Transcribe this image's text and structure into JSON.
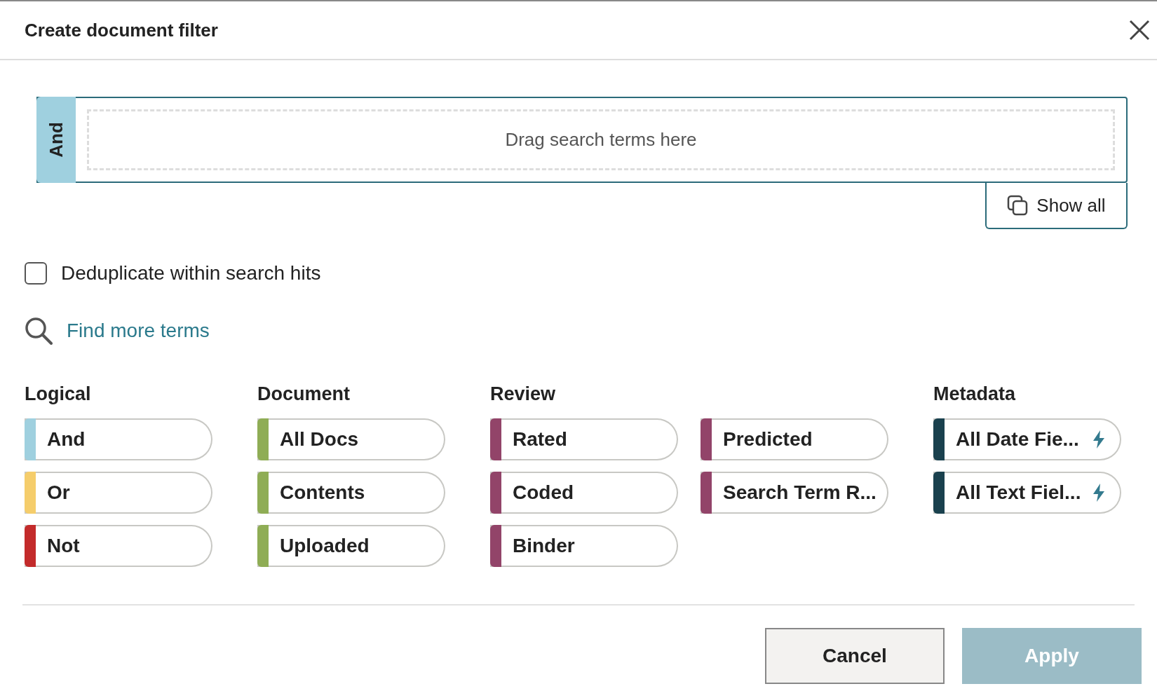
{
  "dialog": {
    "title": "Create document filter"
  },
  "drop_zone": {
    "operator": "And",
    "placeholder": "Drag search terms here"
  },
  "show_all_button": "Show all",
  "dedupe": {
    "label": "Deduplicate within search hits",
    "checked": false
  },
  "find_more_link": "Find more terms",
  "groups": [
    {
      "title": "Logical",
      "terms": [
        {
          "label": "And",
          "kind": "term",
          "color": "#9fd0df"
        },
        {
          "label": "Or",
          "kind": "term",
          "color": "#f5cd6b"
        },
        {
          "label": "Not",
          "kind": "term",
          "color": "#c32b2b"
        }
      ]
    },
    {
      "title": "Document",
      "terms": [
        {
          "label": "All Docs",
          "kind": "term",
          "color": "#8fad55"
        },
        {
          "label": "Contents",
          "kind": "term",
          "color": "#8fad55"
        },
        {
          "label": "Uploaded",
          "kind": "term",
          "color": "#8fad55"
        }
      ]
    },
    {
      "title": "Review",
      "terms": [
        {
          "label": "Rated",
          "kind": "term",
          "color": "#924469"
        },
        {
          "label": "Coded",
          "kind": "term",
          "color": "#924469"
        },
        {
          "label": "Binder",
          "kind": "term",
          "color": "#924469"
        },
        {
          "label": "Predicted",
          "kind": "term",
          "color": "#924469"
        },
        {
          "label": "Search Term R...",
          "kind": "term",
          "color": "#924469"
        }
      ]
    },
    {
      "title": "Metadata",
      "terms": [
        {
          "label": "All Date Fie...",
          "kind": "field",
          "color": "#1a414e"
        },
        {
          "label": "All Text Fiel...",
          "kind": "field",
          "color": "#1a414e"
        }
      ]
    }
  ],
  "buttons": [
    {
      "label": "Cancel",
      "kind": "secondary",
      "disabled": false
    },
    {
      "label": "Apply",
      "kind": "primary",
      "disabled": true
    }
  ]
}
